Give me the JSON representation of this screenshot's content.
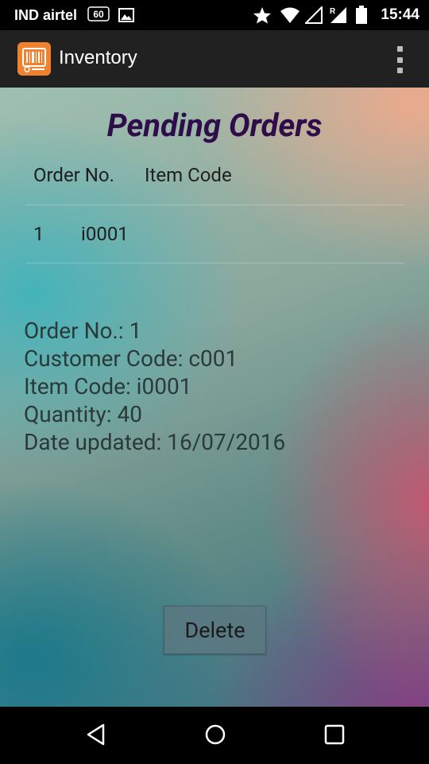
{
  "status_bar": {
    "carrier": "IND airtel",
    "network_badge": "60",
    "roaming": "R",
    "time": "15:44",
    "icons": [
      "image-icon",
      "star-icon",
      "wifi-icon",
      "signal-icon",
      "battery-icon"
    ]
  },
  "app_bar": {
    "title": "Inventory",
    "logo_icon": "barcode-icon",
    "menu_icon": "overflow-menu-icon",
    "logo_color": "#f0812e"
  },
  "page": {
    "title": "Pending Orders",
    "title_color": "#2e0d4a"
  },
  "table": {
    "headers": [
      "Order No.",
      "Item Code"
    ],
    "rows": [
      [
        "1",
        "i0001"
      ]
    ]
  },
  "details": {
    "order_no": "Order No.: 1",
    "customer_code": "Customer Code: c001",
    "item_code": "Item Code: i0001",
    "quantity": "Quantity: 40",
    "date_updated": "Date updated: 16/07/2016"
  },
  "actions": {
    "delete_label": "Delete"
  },
  "nav_bar": {
    "icons": [
      "back-icon",
      "home-icon",
      "recents-icon"
    ]
  }
}
